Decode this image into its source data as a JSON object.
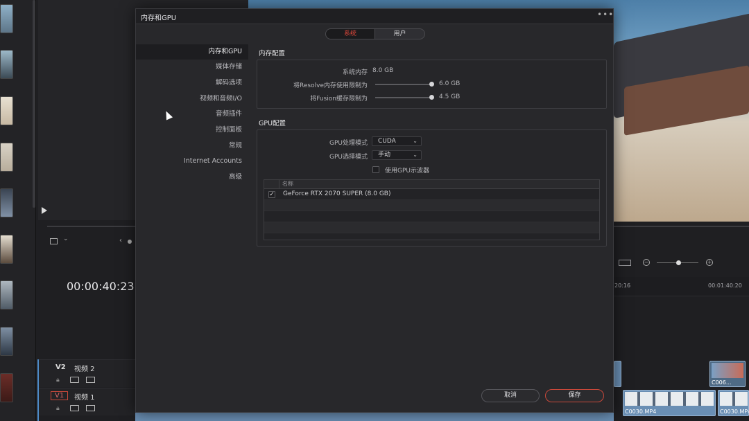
{
  "app": {
    "timecode": "00:00:40:23",
    "ruler_ticks": [
      "20:16",
      "00:01:40:20"
    ],
    "tracks": [
      {
        "id": "V2",
        "name": "视频 2"
      },
      {
        "id": "V1",
        "name": "视频 1"
      }
    ],
    "clips": [
      "C006...",
      "C0030.MP4",
      "C0030.MP4"
    ]
  },
  "dialog": {
    "title": "内存和GPU",
    "more_glyph": "•••",
    "tabs": [
      {
        "label": "系统",
        "active": true
      },
      {
        "label": "用户",
        "active": false
      }
    ],
    "nav": [
      {
        "label": "内存和GPU",
        "active": true
      },
      {
        "label": "媒体存储",
        "active": false
      },
      {
        "label": "解码选项",
        "active": false
      },
      {
        "label": "视频和音频I/O",
        "active": false
      },
      {
        "label": "音频插件",
        "active": false
      },
      {
        "label": "控制面板",
        "active": false
      },
      {
        "label": "常规",
        "active": false
      },
      {
        "label": "Internet Accounts",
        "active": false
      },
      {
        "label": "高级",
        "active": false
      }
    ],
    "memory": {
      "title": "内存配置",
      "system_memory_label": "系统内存",
      "system_memory_value": "8.0 GB",
      "resolve_limit_label": "将Resolve内存使用限制为",
      "resolve_limit_value": "6.0 GB",
      "resolve_limit_fraction": 0.98,
      "fusion_limit_label": "将Fusion缓存限制为",
      "fusion_limit_value": "4.5 GB",
      "fusion_limit_fraction": 0.98
    },
    "gpu": {
      "title": "GPU配置",
      "processing_mode_label": "GPU处理模式",
      "processing_mode_value": "CUDA",
      "selection_mode_label": "GPU选择模式",
      "selection_mode_value": "手动",
      "show_scope_label": "使用GPU示波器",
      "show_scope_checked": false,
      "table_header": "名称",
      "gpus": [
        {
          "name": "GeForce RTX 2070 SUPER (8.0 GB)",
          "checked": true
        }
      ]
    },
    "buttons": {
      "cancel": "取消",
      "save": "保存"
    }
  },
  "colors": {
    "accent_red": "#e0483b",
    "dialog_bg": "#28282b",
    "clip_blue": "#6a8fb4"
  }
}
